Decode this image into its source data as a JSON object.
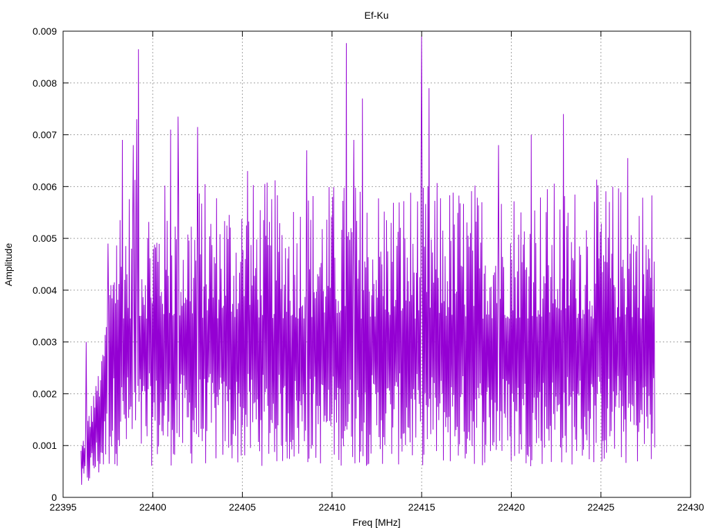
{
  "chart_data": {
    "type": "line",
    "title": "Ef-Ku",
    "xlabel": "Freq [MHz]",
    "ylabel": "Amplitude",
    "xlim": [
      22395,
      22430
    ],
    "ylim": [
      0,
      0.009
    ],
    "x_ticks": [
      "22395",
      "22400",
      "22405",
      "22410",
      "22415",
      "22420",
      "22425",
      "22430"
    ],
    "y_ticks": [
      "0",
      "0.001",
      "0.002",
      "0.003",
      "0.004",
      "0.005",
      "0.006",
      "0.007",
      "0.008",
      "0.009"
    ],
    "x_tick_values": [
      22395,
      22400,
      22405,
      22410,
      22415,
      22420,
      22425,
      22430
    ],
    "y_tick_values": [
      0,
      0.001,
      0.002,
      0.003,
      0.004,
      0.005,
      0.006,
      0.007,
      0.008,
      0.009
    ],
    "grid": true,
    "color": "#9400d3",
    "series": [
      {
        "name": "",
        "x_start": 22396.0,
        "x_end": 22428.0,
        "samples": 1000,
        "notable_peaks": [
          {
            "x": 22399.2,
            "y": 0.00865
          },
          {
            "x": 22399.1,
            "y": 0.0073
          },
          {
            "x": 22398.3,
            "y": 0.0069
          },
          {
            "x": 22398.9,
            "y": 0.0068
          },
          {
            "x": 22401.0,
            "y": 0.0071
          },
          {
            "x": 22401.4,
            "y": 0.00735
          },
          {
            "x": 22402.5,
            "y": 0.00715
          },
          {
            "x": 22410.8,
            "y": 0.00877
          },
          {
            "x": 22411.7,
            "y": 0.0077
          },
          {
            "x": 22411.2,
            "y": 0.0069
          },
          {
            "x": 22415.0,
            "y": 0.0089
          },
          {
            "x": 22415.4,
            "y": 0.0079
          },
          {
            "x": 22422.9,
            "y": 0.0074
          },
          {
            "x": 22421.1,
            "y": 0.007
          },
          {
            "x": 22419.3,
            "y": 0.0068
          },
          {
            "x": 22426.5,
            "y": 0.00655
          },
          {
            "x": 22408.6,
            "y": 0.0067
          },
          {
            "x": 22405.3,
            "y": 0.0063
          },
          {
            "x": 22397.5,
            "y": 0.0049
          },
          {
            "x": 22396.3,
            "y": 0.003
          }
        ]
      }
    ]
  }
}
